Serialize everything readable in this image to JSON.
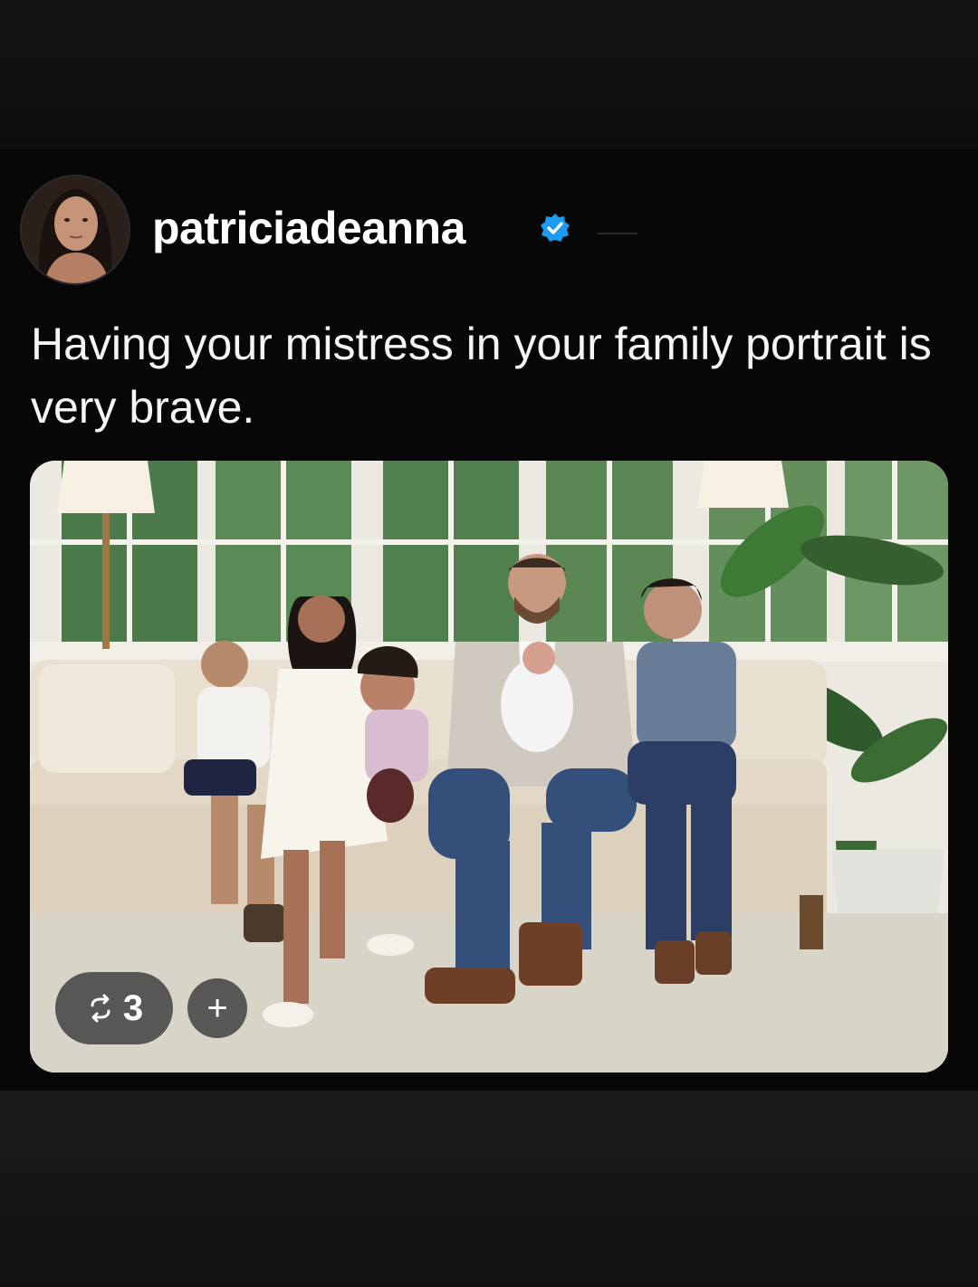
{
  "post": {
    "username": "patriciadeanna",
    "verified": true,
    "text": "Having your mistress in your family portrait is very brave.",
    "repost_count": "3",
    "add_label": "+"
  },
  "icons": {
    "verified": "verified-badge-icon",
    "repost": "repost-icon",
    "add": "plus-icon"
  },
  "colors": {
    "background": "#0b0b0b",
    "verified_blue": "#1d9bf0",
    "pill": "#464646"
  }
}
